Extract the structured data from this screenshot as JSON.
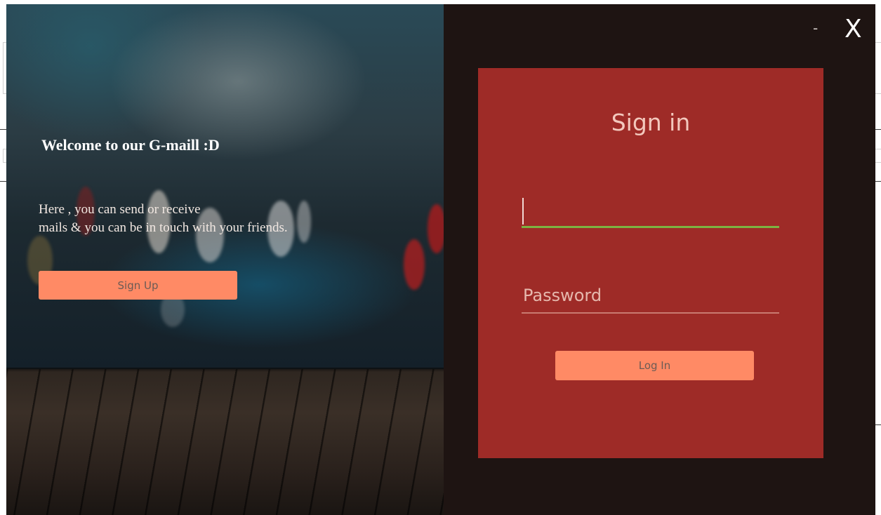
{
  "welcome": {
    "title": "Welcome to our G-maill :D",
    "text": "Here , you can send or receive\nmails & you can be in touch with your friends."
  },
  "buttons": {
    "signup_label": "Sign Up",
    "login_label": "Log In"
  },
  "window_controls": {
    "minimize_label": "-",
    "close_label": "X"
  },
  "signin": {
    "title": "Sign in",
    "username_value": "",
    "password_placeholder": "Password"
  },
  "colors": {
    "window_bg": "#1e1412",
    "card_bg": "#9e2b27",
    "button_bg": "#ff8a65",
    "focus_underline": "#7cb342"
  }
}
